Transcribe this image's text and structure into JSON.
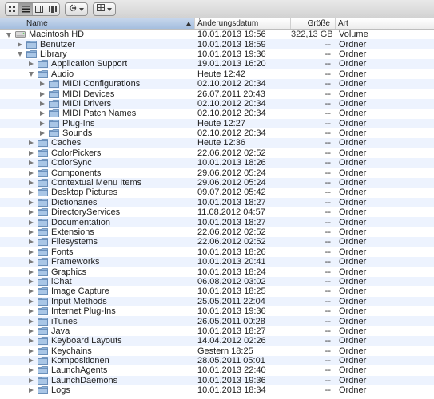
{
  "toolbar": {
    "view_buttons": [
      "icon-view-icon",
      "list-view-icon",
      "column-view-icon",
      "coverflow-view-icon"
    ],
    "action_icon": "gear-icon",
    "arrange_icon": "grid-arrange-icon"
  },
  "columns": {
    "name": "Name",
    "date": "Änderungsdatum",
    "size": "Größe",
    "kind": "Art"
  },
  "rows": [
    {
      "depth": 0,
      "disclosure": "open",
      "icon": "hard-drive-icon",
      "name": "Macintosh HD",
      "date": "10.01.2013 19:56",
      "size": "322,13 GB",
      "kind": "Volume"
    },
    {
      "depth": 1,
      "disclosure": "closed",
      "icon": "folder-icon",
      "name": "Benutzer",
      "date": "10.01.2013 18:59",
      "size": "--",
      "kind": "Ordner"
    },
    {
      "depth": 1,
      "disclosure": "open",
      "icon": "folder-icon",
      "name": "Library",
      "date": "10.01.2013 19:36",
      "size": "--",
      "kind": "Ordner"
    },
    {
      "depth": 2,
      "disclosure": "closed",
      "icon": "folder-icon",
      "name": "Application Support",
      "date": "19.01.2013 16:20",
      "size": "--",
      "kind": "Ordner"
    },
    {
      "depth": 2,
      "disclosure": "open",
      "icon": "folder-icon",
      "name": "Audio",
      "date": "Heute 12:42",
      "size": "--",
      "kind": "Ordner"
    },
    {
      "depth": 3,
      "disclosure": "closed",
      "icon": "folder-icon",
      "name": "MIDI Configurations",
      "date": "02.10.2012 20:34",
      "size": "--",
      "kind": "Ordner"
    },
    {
      "depth": 3,
      "disclosure": "closed",
      "icon": "folder-icon",
      "name": "MIDI Devices",
      "date": "26.07.2011 20:43",
      "size": "--",
      "kind": "Ordner"
    },
    {
      "depth": 3,
      "disclosure": "closed",
      "icon": "folder-icon",
      "name": "MIDI Drivers",
      "date": "02.10.2012 20:34",
      "size": "--",
      "kind": "Ordner"
    },
    {
      "depth": 3,
      "disclosure": "closed",
      "icon": "folder-icon",
      "name": "MIDI Patch Names",
      "date": "02.10.2012 20:34",
      "size": "--",
      "kind": "Ordner"
    },
    {
      "depth": 3,
      "disclosure": "closed",
      "icon": "folder-icon",
      "name": "Plug-Ins",
      "date": "Heute 12:27",
      "size": "--",
      "kind": "Ordner"
    },
    {
      "depth": 3,
      "disclosure": "closed",
      "icon": "folder-icon",
      "name": "Sounds",
      "date": "02.10.2012 20:34",
      "size": "--",
      "kind": "Ordner"
    },
    {
      "depth": 2,
      "disclosure": "closed",
      "icon": "folder-icon",
      "name": "Caches",
      "date": "Heute 12:36",
      "size": "--",
      "kind": "Ordner"
    },
    {
      "depth": 2,
      "disclosure": "closed",
      "icon": "folder-icon",
      "name": "ColorPickers",
      "date": "22.06.2012 02:52",
      "size": "--",
      "kind": "Ordner"
    },
    {
      "depth": 2,
      "disclosure": "closed",
      "icon": "folder-icon",
      "name": "ColorSync",
      "date": "10.01.2013 18:26",
      "size": "--",
      "kind": "Ordner"
    },
    {
      "depth": 2,
      "disclosure": "closed",
      "icon": "folder-icon",
      "name": "Components",
      "date": "29.06.2012 05:24",
      "size": "--",
      "kind": "Ordner"
    },
    {
      "depth": 2,
      "disclosure": "closed",
      "icon": "folder-icon",
      "name": "Contextual Menu Items",
      "date": "29.06.2012 05:24",
      "size": "--",
      "kind": "Ordner"
    },
    {
      "depth": 2,
      "disclosure": "closed",
      "icon": "folder-icon",
      "name": "Desktop Pictures",
      "date": "09.07.2012 05:42",
      "size": "--",
      "kind": "Ordner"
    },
    {
      "depth": 2,
      "disclosure": "closed",
      "icon": "folder-icon",
      "name": "Dictionaries",
      "date": "10.01.2013 18:27",
      "size": "--",
      "kind": "Ordner"
    },
    {
      "depth": 2,
      "disclosure": "closed",
      "icon": "folder-icon",
      "name": "DirectoryServices",
      "date": "11.08.2012 04:57",
      "size": "--",
      "kind": "Ordner"
    },
    {
      "depth": 2,
      "disclosure": "closed",
      "icon": "folder-icon",
      "name": "Documentation",
      "date": "10.01.2013 18:27",
      "size": "--",
      "kind": "Ordner"
    },
    {
      "depth": 2,
      "disclosure": "closed",
      "icon": "folder-icon",
      "name": "Extensions",
      "date": "22.06.2012 02:52",
      "size": "--",
      "kind": "Ordner"
    },
    {
      "depth": 2,
      "disclosure": "closed",
      "icon": "folder-icon",
      "name": "Filesystems",
      "date": "22.06.2012 02:52",
      "size": "--",
      "kind": "Ordner"
    },
    {
      "depth": 2,
      "disclosure": "closed",
      "icon": "folder-icon",
      "name": "Fonts",
      "date": "10.01.2013 18:26",
      "size": "--",
      "kind": "Ordner"
    },
    {
      "depth": 2,
      "disclosure": "closed",
      "icon": "folder-icon",
      "name": "Frameworks",
      "date": "10.01.2013 20:41",
      "size": "--",
      "kind": "Ordner"
    },
    {
      "depth": 2,
      "disclosure": "closed",
      "icon": "folder-icon",
      "name": "Graphics",
      "date": "10.01.2013 18:24",
      "size": "--",
      "kind": "Ordner"
    },
    {
      "depth": 2,
      "disclosure": "closed",
      "icon": "folder-icon",
      "name": "iChat",
      "date": "06.08.2012 03:02",
      "size": "--",
      "kind": "Ordner"
    },
    {
      "depth": 2,
      "disclosure": "closed",
      "icon": "folder-icon",
      "name": "Image Capture",
      "date": "10.01.2013 18:25",
      "size": "--",
      "kind": "Ordner"
    },
    {
      "depth": 2,
      "disclosure": "closed",
      "icon": "folder-icon",
      "name": "Input Methods",
      "date": "25.05.2011 22:04",
      "size": "--",
      "kind": "Ordner"
    },
    {
      "depth": 2,
      "disclosure": "closed",
      "icon": "folder-icon",
      "name": "Internet Plug-Ins",
      "date": "10.01.2013 19:36",
      "size": "--",
      "kind": "Ordner"
    },
    {
      "depth": 2,
      "disclosure": "closed",
      "icon": "folder-icon",
      "name": "iTunes",
      "date": "26.05.2011 00:28",
      "size": "--",
      "kind": "Ordner"
    },
    {
      "depth": 2,
      "disclosure": "closed",
      "icon": "folder-icon",
      "name": "Java",
      "date": "10.01.2013 18:27",
      "size": "--",
      "kind": "Ordner"
    },
    {
      "depth": 2,
      "disclosure": "closed",
      "icon": "folder-icon",
      "name": "Keyboard Layouts",
      "date": "14.04.2012 02:26",
      "size": "--",
      "kind": "Ordner"
    },
    {
      "depth": 2,
      "disclosure": "closed",
      "icon": "folder-icon",
      "name": "Keychains",
      "date": "Gestern 18:25",
      "size": "--",
      "kind": "Ordner"
    },
    {
      "depth": 2,
      "disclosure": "closed",
      "icon": "folder-icon",
      "name": "Kompositionen",
      "date": "28.05.2011 05:01",
      "size": "--",
      "kind": "Ordner"
    },
    {
      "depth": 2,
      "disclosure": "closed",
      "icon": "folder-icon",
      "name": "LaunchAgents",
      "date": "10.01.2013 22:40",
      "size": "--",
      "kind": "Ordner"
    },
    {
      "depth": 2,
      "disclosure": "closed",
      "icon": "folder-icon",
      "name": "LaunchDaemons",
      "date": "10.01.2013 19:36",
      "size": "--",
      "kind": "Ordner"
    },
    {
      "depth": 2,
      "disclosure": "closed",
      "icon": "folder-icon",
      "name": "Logs",
      "date": "10.01.2013 18:34",
      "size": "--",
      "kind": "Ordner"
    }
  ]
}
